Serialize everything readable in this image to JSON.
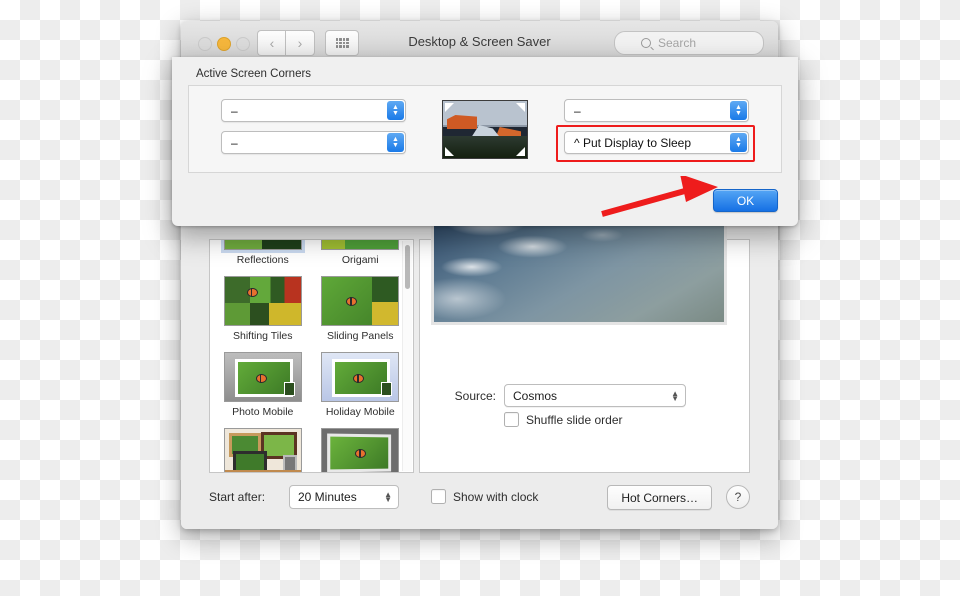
{
  "window": {
    "title": "Desktop & Screen Saver",
    "traffic_lights": [
      "close-inactive",
      "minimize-yellow",
      "zoom-inactive"
    ],
    "nav_back_icon": "chevron-left-icon",
    "nav_forward_icon": "chevron-right-icon",
    "grid_icon": "show-all-grid-icon",
    "search": {
      "placeholder": "Search",
      "value": "",
      "icon": "search-icon"
    }
  },
  "screensaver_list": {
    "items": [
      {
        "label": "Reflections",
        "art": "art-reflect",
        "selected": true
      },
      {
        "label": "Origami",
        "art": "art-origami",
        "selected": false
      },
      {
        "label": "Shifting Tiles",
        "art": "art-tiles",
        "selected": false
      },
      {
        "label": "Sliding Panels",
        "art": "art-panels",
        "selected": false
      },
      {
        "label": "Photo Mobile",
        "art": "art-mobile",
        "selected": false
      },
      {
        "label": "Holiday Mobile",
        "art": "art-mobile holiday",
        "selected": false
      },
      {
        "label": "",
        "art": "art-wall",
        "selected": false
      },
      {
        "label": "",
        "art": "art-shelf",
        "selected": false
      }
    ],
    "scrollbar": "vertical-scrollbar"
  },
  "preview": {
    "image_alt": "earth-from-space-clouds-preview",
    "source_label": "Source:",
    "source_value": "Cosmos",
    "shuffle_label": "Shuffle slide order",
    "shuffle_checked": false
  },
  "bottom_bar": {
    "start_after_label": "Start after:",
    "start_after_value": "20 Minutes",
    "show_clock_label": "Show with clock",
    "show_clock_checked": false,
    "hot_corners_label": "Hot Corners…",
    "help_label": "?"
  },
  "sheet": {
    "title": "Active Screen Corners",
    "corners": {
      "top_left": "–",
      "bottom_left": "–",
      "top_right": "–",
      "bottom_right": "^ Put Display to Sleep"
    },
    "desktop_thumb_alt": "el-capitan-desktop-thumbnail",
    "ok_label": "OK",
    "highlight_color": "#ee1c1c",
    "accent_color": "#1570e4"
  },
  "annotations": {
    "arrow_color": "#ee1c1c",
    "arrow_target": "ok-button"
  }
}
